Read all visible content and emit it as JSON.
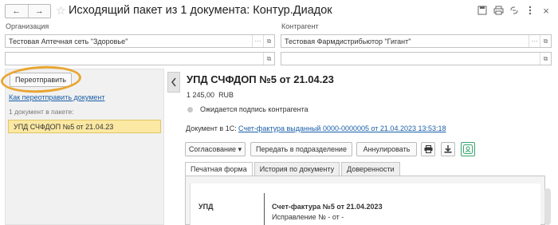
{
  "window": {
    "title": "Исходящий пакет из 1 документа: Контур.Диадок",
    "back_icon": "←",
    "forward_icon": "→",
    "star_icon": "☆"
  },
  "header_fields": {
    "org_label": "Организация",
    "org_value": "Тестовая Аптечная сеть \"Здоровье\"",
    "contr_label": "Контрагент",
    "contr_value": "Тестовая Фармдистрибьютор \"Гигант\"",
    "org_extra_value": "",
    "contr_extra_value": ""
  },
  "left_panel": {
    "resend_button": "Переотправить",
    "how_link": "Как переотправить документ",
    "count_label": "1 документ в пакете:",
    "doc_item": "УПД СЧФДОП №5 от 21.04.23"
  },
  "document": {
    "title": "УПД СЧФДОП №5 от 21.04.23",
    "amount": "1 245,00",
    "currency": "RUB",
    "status": "Ожидается подпись контрагента",
    "doc1c_label": "Документ в 1С:",
    "doc1c_link": "Счет-фактура выданный 0000-0000005 от 21.04.2023 13:53:18"
  },
  "toolbar": {
    "approval": "Согласование",
    "transfer": "Передать в подразделение",
    "cancel": "Аннулировать"
  },
  "tabs": [
    "Печатная форма",
    "История по документу",
    "Доверенности"
  ],
  "preview": {
    "doc_type": "УПД",
    "invoice": "Счет-фактура №5 от 21.04.2023",
    "correction": "Исправление № - от -"
  },
  "colors": {
    "highlight": "#e9a531",
    "selected_item": "#fbe8a3",
    "link": "#1a5fa8"
  }
}
